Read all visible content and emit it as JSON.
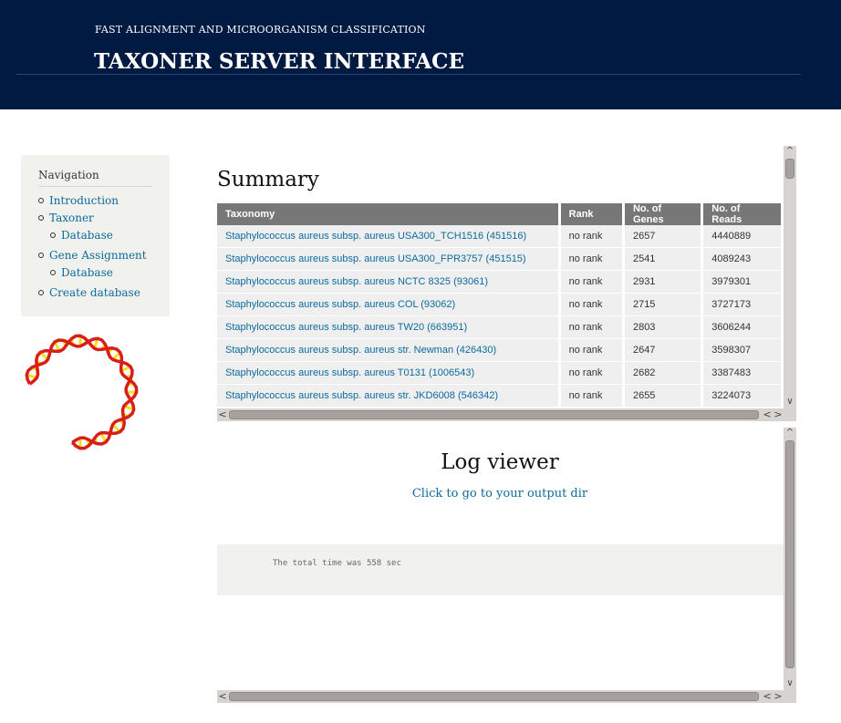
{
  "header": {
    "subtitle": "FAST ALIGNMENT AND MICROORGANISM CLASSIFICATION",
    "title": "TAXONER SERVER INTERFACE"
  },
  "navigation": {
    "title": "Navigation",
    "items": [
      {
        "label": "Introduction",
        "level": 1
      },
      {
        "label": "Taxoner",
        "level": 1
      },
      {
        "label": "Database",
        "level": 2
      },
      {
        "label": "Gene Assignment",
        "level": 1
      },
      {
        "label": "Database",
        "level": 2
      },
      {
        "label": "Create database",
        "level": 1
      }
    ]
  },
  "summary": {
    "title": "Summary",
    "columns": [
      "Taxonomy",
      "Rank",
      "No. of Genes",
      "No. of Reads"
    ],
    "rows": [
      [
        "Staphylococcus aureus subsp. aureus USA300_TCH1516 (451516)",
        "no rank",
        "2657",
        "4440889"
      ],
      [
        "Staphylococcus aureus subsp. aureus USA300_FPR3757 (451515)",
        "no rank",
        "2541",
        "4089243"
      ],
      [
        "Staphylococcus aureus subsp. aureus NCTC 8325 (93061)",
        "no rank",
        "2931",
        "3979301"
      ],
      [
        "Staphylococcus aureus subsp. aureus COL (93062)",
        "no rank",
        "2715",
        "3727173"
      ],
      [
        "Staphylococcus aureus subsp. aureus TW20 (663951)",
        "no rank",
        "2803",
        "3606244"
      ],
      [
        "Staphylococcus aureus subsp. aureus str. Newman (426430)",
        "no rank",
        "2647",
        "3598307"
      ],
      [
        "Staphylococcus aureus subsp. aureus T0131 (1006543)",
        "no rank",
        "2682",
        "3387483"
      ],
      [
        "Staphylococcus aureus subsp. aureus str. JKD6008 (546342)",
        "no rank",
        "2655",
        "3224073"
      ]
    ]
  },
  "log": {
    "title": "Log viewer",
    "link": "Click to go to your output dir",
    "text": "The total time was 558 sec"
  },
  "colors": {
    "header_bg": "#001a42",
    "link": "#0b6a9e",
    "table_header": "#777777"
  }
}
